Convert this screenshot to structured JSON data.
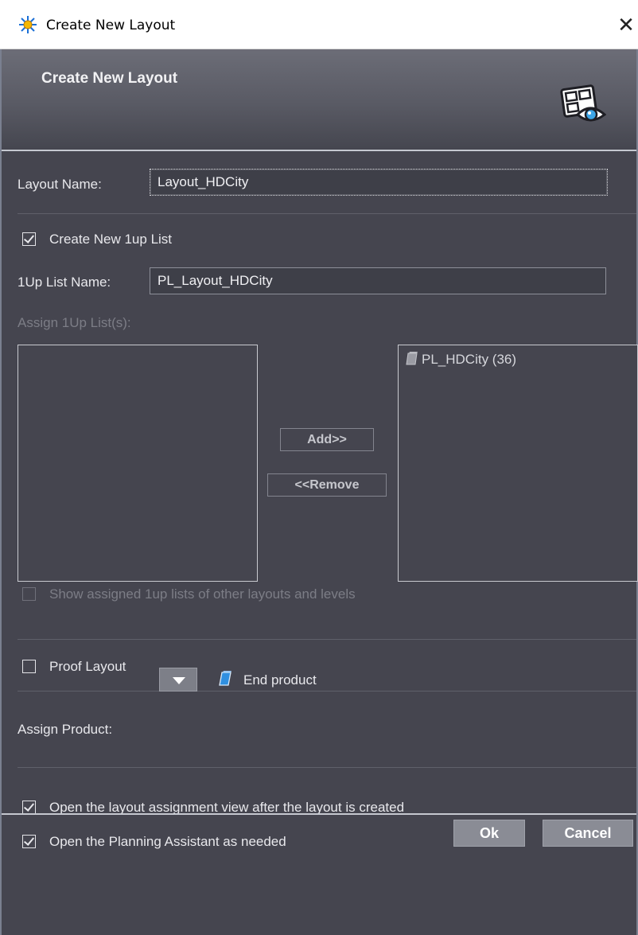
{
  "window": {
    "title": "Create New Layout",
    "close_glyph": "✕"
  },
  "header": {
    "heading": "Create New Layout",
    "icon": "layout-view-icon"
  },
  "layout_name": {
    "label": "Layout Name:",
    "value": "Layout_HDCity"
  },
  "create_1up": {
    "label": "Create New 1up List",
    "checked": true
  },
  "list_name": {
    "label": "1Up List Name:",
    "value": "PL_Layout_HDCity"
  },
  "assign": {
    "label": "Assign 1Up List(s):",
    "available": [],
    "assigned": [
      {
        "label": "PL_HDCity (36)",
        "icon": "document-icon"
      }
    ],
    "add_label": "Add>>",
    "remove_label": "<<Remove",
    "show_other_label": "Show assigned 1up lists of other layouts and levels",
    "show_other_checked": false
  },
  "proof": {
    "label": "Proof Layout",
    "checked": false
  },
  "product": {
    "label": "Assign Product:",
    "value": "End product",
    "icon": "product-icon"
  },
  "options": [
    {
      "label": "Open the layout assignment view after the layout is created",
      "checked": true
    },
    {
      "label": "Open the Planning Assistant as needed",
      "checked": true
    }
  ],
  "buttons": {
    "ok": "Ok",
    "cancel": "Cancel"
  },
  "colors": {
    "background": "#45454f",
    "header_gradient_top": "#6c6d77",
    "button_fill": "#8a8c95"
  }
}
